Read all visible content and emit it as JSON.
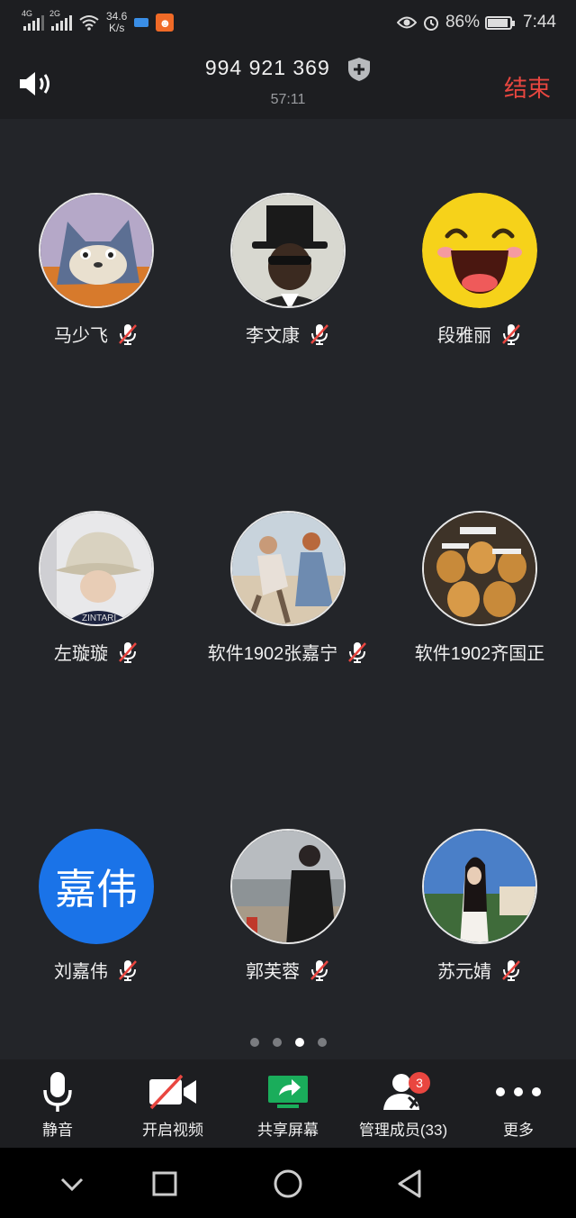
{
  "status_bar": {
    "net1": "4G",
    "net2": "2G",
    "speed_value": "34.6",
    "speed_unit": "K/s",
    "battery": "86%",
    "time": "7:44"
  },
  "header": {
    "meeting_id": "994 921 369",
    "timer": "57:11",
    "end_label": "结束"
  },
  "participants": [
    {
      "name": "马少飞",
      "avatar": "cartoon-cat-avatar"
    },
    {
      "name": "李文康",
      "avatar": "top-hat-man-avatar"
    },
    {
      "name": "段雅丽",
      "avatar": "laughing-emoji-avatar"
    },
    {
      "name": "左璇璇",
      "avatar": "bucket-hat-avatar"
    },
    {
      "name": "软件1902张嘉宁",
      "avatar": "dancing-couple-avatar"
    },
    {
      "name": "软件1902齐国正",
      "avatar": "bears-meme-avatar"
    },
    {
      "name": "刘嘉伟",
      "avatar_text": "嘉伟"
    },
    {
      "name": "郭芙蓉",
      "avatar": "seaside-man-avatar"
    },
    {
      "name": "苏元婧",
      "avatar": "girl-outdoor-avatar"
    }
  ],
  "page_indicator": {
    "total": 4,
    "current": 3
  },
  "toolbar": {
    "mute": "静音",
    "video": "开启视频",
    "share": "共享屏幕",
    "members": "管理成员(33)",
    "members_badge": "3",
    "more": "更多"
  },
  "colors": {
    "accent_blue": "#1a73e8",
    "end_red": "#e7463f",
    "share_green": "#1aad5b",
    "badge_red": "#e94640"
  }
}
